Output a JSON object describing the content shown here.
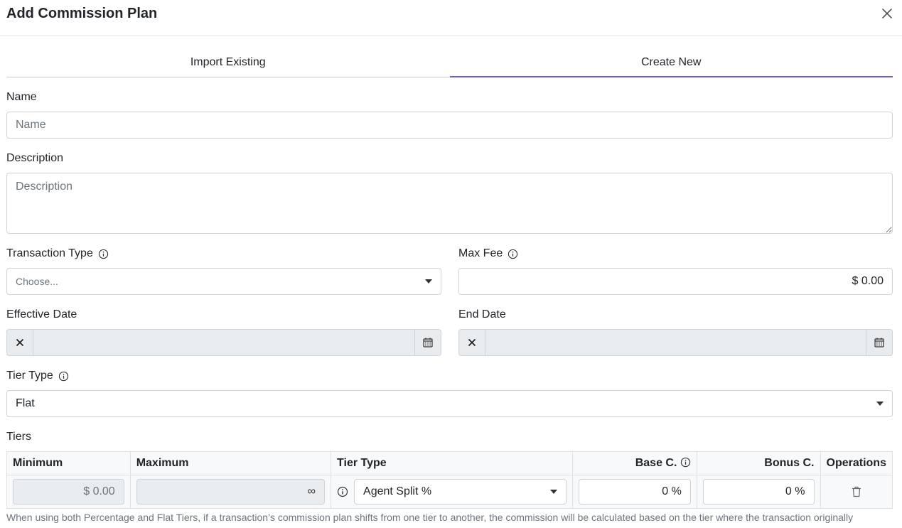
{
  "modal": {
    "title": "Add Commission Plan"
  },
  "tabs": [
    {
      "label": "Import Existing",
      "active": false
    },
    {
      "label": "Create New",
      "active": true
    }
  ],
  "form": {
    "name": {
      "label": "Name",
      "placeholder": "Name",
      "value": ""
    },
    "description": {
      "label": "Description",
      "placeholder": "Description",
      "value": ""
    },
    "transaction_type": {
      "label": "Transaction Type",
      "placeholder": "Choose..."
    },
    "max_fee": {
      "label": "Max Fee",
      "value": "$ 0.00"
    },
    "effective_date": {
      "label": "Effective Date",
      "value": ""
    },
    "end_date": {
      "label": "End Date",
      "value": ""
    },
    "tier_type": {
      "label": "Tier Type",
      "value": "Flat"
    }
  },
  "tiers": {
    "label": "Tiers",
    "columns": [
      "Minimum",
      "Maximum",
      "Tier Type",
      "Base C.",
      "Bonus C.",
      "Operations"
    ],
    "rows": [
      {
        "minimum": "$ 0.00",
        "maximum": "∞",
        "tier_type": "Agent Split %",
        "base": "0 %",
        "bonus": "0 %"
      }
    ],
    "footnote": "When using both Percentage and Flat Tiers, if a transaction’s commission plan shifts from one tier to another, the commission will be calculated based on the tier where the transaction originally"
  },
  "colors": {
    "accent": "#6a5fcf",
    "border": "#ced4da",
    "disabled_bg": "#e9ecef"
  },
  "icons": {
    "close": "close-icon",
    "info": "info-icon",
    "calendar": "calendar-icon",
    "clear": "clear-icon",
    "trash": "trash-icon",
    "caret": "caret-down-icon"
  }
}
